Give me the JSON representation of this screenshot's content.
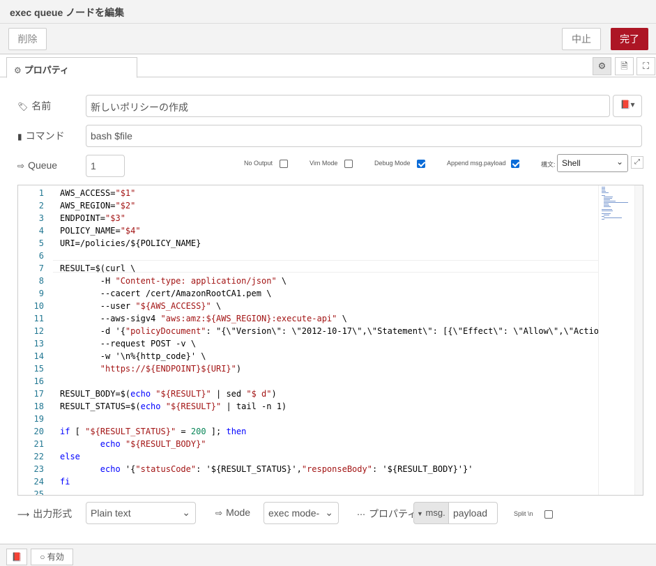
{
  "dialog": {
    "title": "exec queue ノードを編集"
  },
  "buttons": {
    "delete": "削除",
    "cancel": "中止",
    "done": "完了"
  },
  "tabs": [
    {
      "label": "プロパティ",
      "icon": "gear-icon"
    }
  ],
  "side_buttons": [
    {
      "icon": "gear-icon"
    },
    {
      "icon": "document-icon"
    },
    {
      "icon": "frame-icon"
    }
  ],
  "form": {
    "name": {
      "label": "名前",
      "icon": "tag-icon",
      "value": "新しいポリシーの作成",
      "book_button_icon": "book-icon"
    },
    "command": {
      "label": "コマンド",
      "icon": "file-icon",
      "value": "bash $file"
    },
    "queue": {
      "label": "Queue",
      "icon": "sign-in-icon",
      "value": "1"
    },
    "options": {
      "no_output": {
        "label": "No Output",
        "checked": false
      },
      "vim_mode": {
        "label": "Vim Mode",
        "checked": false
      },
      "debug_mode": {
        "label": "Debug Mode",
        "checked": true
      },
      "append_payload": {
        "label": "Append msg.payload",
        "checked": true
      }
    },
    "syntax": {
      "label": "構文:",
      "value": "Shell"
    },
    "output_format": {
      "label": "出力形式",
      "icon": "arrow-right-icon",
      "value": "Plain text"
    },
    "mode": {
      "label": "Mode",
      "icon": "sign-in-icon",
      "value": "exec mode-"
    },
    "property": {
      "label": "プロパティ",
      "icon": "ellipsis-icon",
      "prefix": "msg.",
      "value": "payload"
    },
    "split": {
      "label": "Split \\n",
      "checked": false
    }
  },
  "editor": {
    "lines": [
      "AWS_ACCESS=\"$1\"",
      "AWS_REGION=\"$2\"",
      "ENDPOINT=\"$3\"",
      "POLICY_NAME=\"$4\"",
      "URI=/policies/${POLICY_NAME}",
      "",
      "RESULT=$(curl \\",
      "        -H \"Content-type: application/json\" \\",
      "        --cacert /cert/AmazonRootCA1.pem \\",
      "        --user \"${AWS_ACCESS}\" \\",
      "        --aws-sigv4 \"aws:amz:${AWS_REGION}:execute-api\" \\",
      "        -d '{\"policyDocument\": \"{\\\"Version\\\": \\\"2012-10-17\\\",\\\"Statement\\\": [{\\\"Effect\\\": \\\"Allow\\\",\\\"Action",
      "        --request POST -v \\",
      "        -w '\\n%{http_code}' \\",
      "        \"https://${ENDPOINT}${URI}\")",
      "",
      "RESULT_BODY=$(echo \"${RESULT}\" | sed \"$ d\")",
      "RESULT_STATUS=$(echo \"${RESULT}\" | tail -n 1)",
      "",
      "if [ \"${RESULT_STATUS}\" = 200 ]; then",
      "        echo \"${RESULT_BODY}\"",
      "else",
      "        echo '{\"statusCode\": '${RESULT_STATUS}',\"responseBody\": '${RESULT_BODY}'}'",
      "fi",
      ""
    ]
  },
  "footer": {
    "book_icon": "book-icon",
    "enabled_label": "有効",
    "enabled_icon": "circle-icon"
  }
}
